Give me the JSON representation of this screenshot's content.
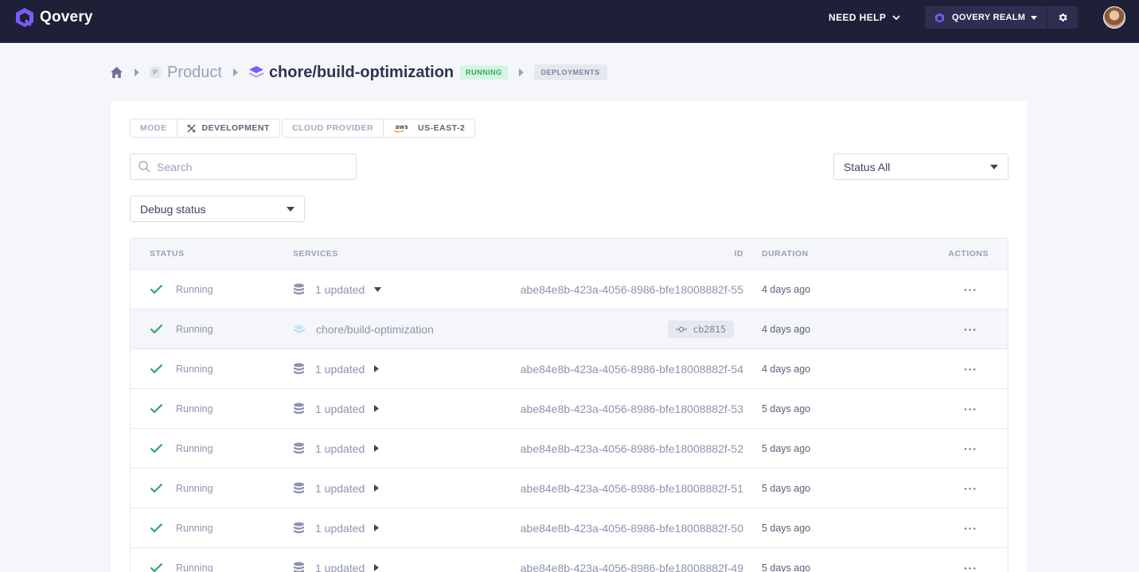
{
  "app": {
    "name": "Qovery"
  },
  "topbar": {
    "need_help": "NEED HELP",
    "org": "QOVERY REALM"
  },
  "breadcrumb": {
    "project_initial": "P",
    "project": "Product",
    "environment": "chore/build-optimization",
    "env_status": "RUNNING",
    "section": "DEPLOYMENTS"
  },
  "env_tags": {
    "mode_label": "MODE",
    "mode_value": "DEVELOPMENT",
    "provider_label": "CLOUD PROVIDER",
    "provider_logo": "aws",
    "region": "US-EAST-2"
  },
  "filters": {
    "search_placeholder": "Search",
    "status_filter": "Status All",
    "debug_status": "Debug status"
  },
  "table": {
    "columns": {
      "status": "STATUS",
      "services": "SERVICES",
      "id": "ID",
      "duration": "DURATION",
      "actions": "ACTIONS"
    },
    "rows": [
      {
        "status": "Running",
        "services": "1 updated",
        "id": "abe84e8b-423a-4056-8986-bfe18008882f-55",
        "duration": "4 days ago",
        "expanded": true
      },
      {
        "status": "Running",
        "services": "chore/build-optimization",
        "commit": "cb2815",
        "duration": "4 days ago",
        "child": true
      },
      {
        "status": "Running",
        "services": "1 updated",
        "id": "abe84e8b-423a-4056-8986-bfe18008882f-54",
        "duration": "4 days ago"
      },
      {
        "status": "Running",
        "services": "1 updated",
        "id": "abe84e8b-423a-4056-8986-bfe18008882f-53",
        "duration": "5 days ago"
      },
      {
        "status": "Running",
        "services": "1 updated",
        "id": "abe84e8b-423a-4056-8986-bfe18008882f-52",
        "duration": "5 days ago"
      },
      {
        "status": "Running",
        "services": "1 updated",
        "id": "abe84e8b-423a-4056-8986-bfe18008882f-51",
        "duration": "5 days ago"
      },
      {
        "status": "Running",
        "services": "1 updated",
        "id": "abe84e8b-423a-4056-8986-bfe18008882f-50",
        "duration": "5 days ago"
      },
      {
        "status": "Running",
        "services": "1 updated",
        "id": "abe84e8b-423a-4056-8986-bfe18008882f-49",
        "duration": "5 days ago"
      }
    ],
    "actions_glyph": "···"
  },
  "colors": {
    "topbar_bg": "#1e2038",
    "accent": "#7b5cf5",
    "running_green": "#2ea866",
    "page_bg": "#f5f6f9"
  }
}
